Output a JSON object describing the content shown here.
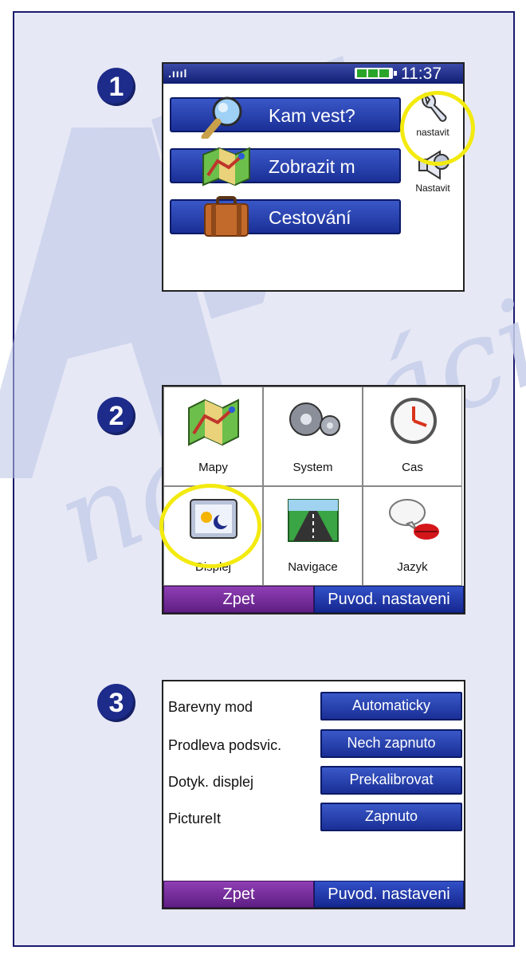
{
  "watermark": {
    "text_big": "AN",
    "text_script": "navigácia"
  },
  "steps": [
    "1",
    "2",
    "3"
  ],
  "screen1": {
    "status": {
      "time": "11:37",
      "signal_icon": "signal-bars-icon",
      "battery_icon": "battery-icon"
    },
    "menu": [
      {
        "label": "Kam vest?",
        "icon": "magnifier-icon"
      },
      {
        "label": "Zobrazit m",
        "icon": "map-icon"
      },
      {
        "label": "Cestování",
        "icon": "suitcase-icon"
      }
    ],
    "side": [
      {
        "label": "nastavit",
        "icon": "wrench-icon"
      },
      {
        "label": "Nastavit",
        "icon": "speaker-icon"
      }
    ]
  },
  "screen2": {
    "tiles": [
      {
        "label": "Mapy",
        "icon": "map-icon"
      },
      {
        "label": "System",
        "icon": "gears-icon"
      },
      {
        "label": "Cas",
        "icon": "clock-icon"
      },
      {
        "label": "Displej",
        "icon": "display-icon"
      },
      {
        "label": "Navigace",
        "icon": "road-icon"
      },
      {
        "label": "Jazyk",
        "icon": "speech-lips-icon"
      }
    ],
    "back": "Zpet",
    "reset": "Puvod. nastaveni"
  },
  "screen3": {
    "rows": [
      {
        "label": "Barevny mod",
        "value": "Automaticky"
      },
      {
        "label": "Prodleva podsvic.",
        "value": "Nech zapnuto"
      },
      {
        "label": "Dotyk. displej",
        "value": "Prekalibrovat"
      },
      {
        "label": "PictureIt",
        "value": "Zapnuto"
      }
    ],
    "back": "Zpet",
    "reset": "Puvod. nastaveni"
  },
  "colors": {
    "accent_blue": "#1a2f96",
    "back_purple": "#6a2590",
    "highlight": "#f3ea10",
    "panel_bg": "#e7e8f5"
  }
}
